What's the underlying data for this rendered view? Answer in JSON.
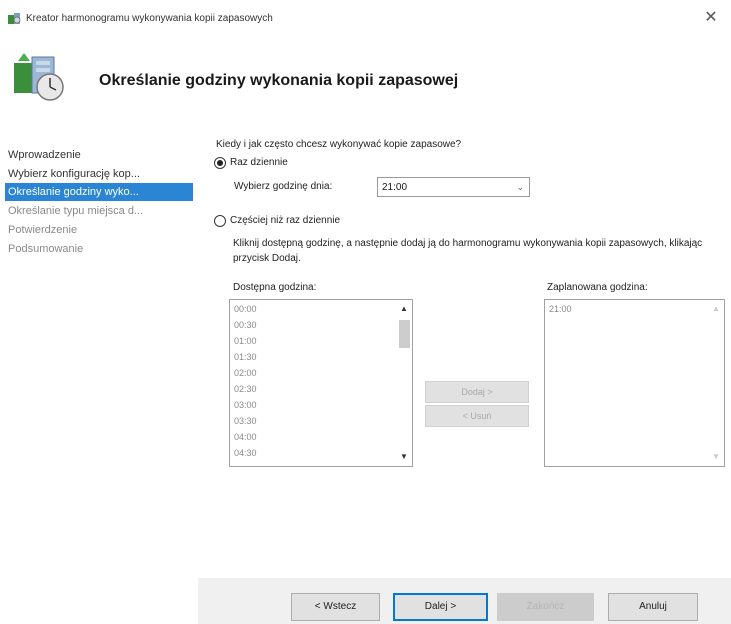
{
  "window": {
    "title": "Kreator harmonogramu wykonywania kopii zapasowych",
    "close_glyph": "✕"
  },
  "header": {
    "title": "Określanie godziny wykonania kopii zapasowej",
    "icon": "backup-clock-icon"
  },
  "nav": {
    "items": [
      {
        "label": "Wprowadzenie",
        "state": "normal"
      },
      {
        "label": "Wybierz konfigurację kop...",
        "state": "normal"
      },
      {
        "label": "Określanie godziny wyko...",
        "state": "selected"
      },
      {
        "label": "Określanie typu miejsca d...",
        "state": "disabled"
      },
      {
        "label": "Potwierdzenie",
        "state": "disabled"
      },
      {
        "label": "Podsumowanie",
        "state": "disabled"
      }
    ]
  },
  "main": {
    "question": "Kiedy i jak często chcesz wykonywać kopie zapasowe?",
    "once_daily": {
      "label": "Raz dziennie",
      "checked": true,
      "time_label": "Wybierz godzinę dnia:",
      "time_value": "21:00"
    },
    "more_often": {
      "label": "Częściej niż raz dziennie",
      "checked": false,
      "description": "Kliknij dostępną godzinę, a następnie dodaj ją do harmonogramu wykonywania kopii zapasowych, klikając przycisk Dodaj.",
      "available_title": "Dostępna godzina:",
      "available_times": [
        "00:00",
        "00:30",
        "01:00",
        "01:30",
        "02:00",
        "02:30",
        "03:00",
        "03:30",
        "04:00",
        "04:30"
      ],
      "scheduled_title": "Zaplanowana godzina:",
      "scheduled_times": [
        "21:00"
      ],
      "add_label": "Dodaj >",
      "remove_label": "< Usuń"
    }
  },
  "footer": {
    "back_label": "< Wstecz",
    "next_label": "Dalej >",
    "finish_label": "Zakończ",
    "cancel_label": "Anuluj"
  },
  "colors": {
    "accent": "#2a86d5",
    "default_button_border": "#0078d7"
  }
}
